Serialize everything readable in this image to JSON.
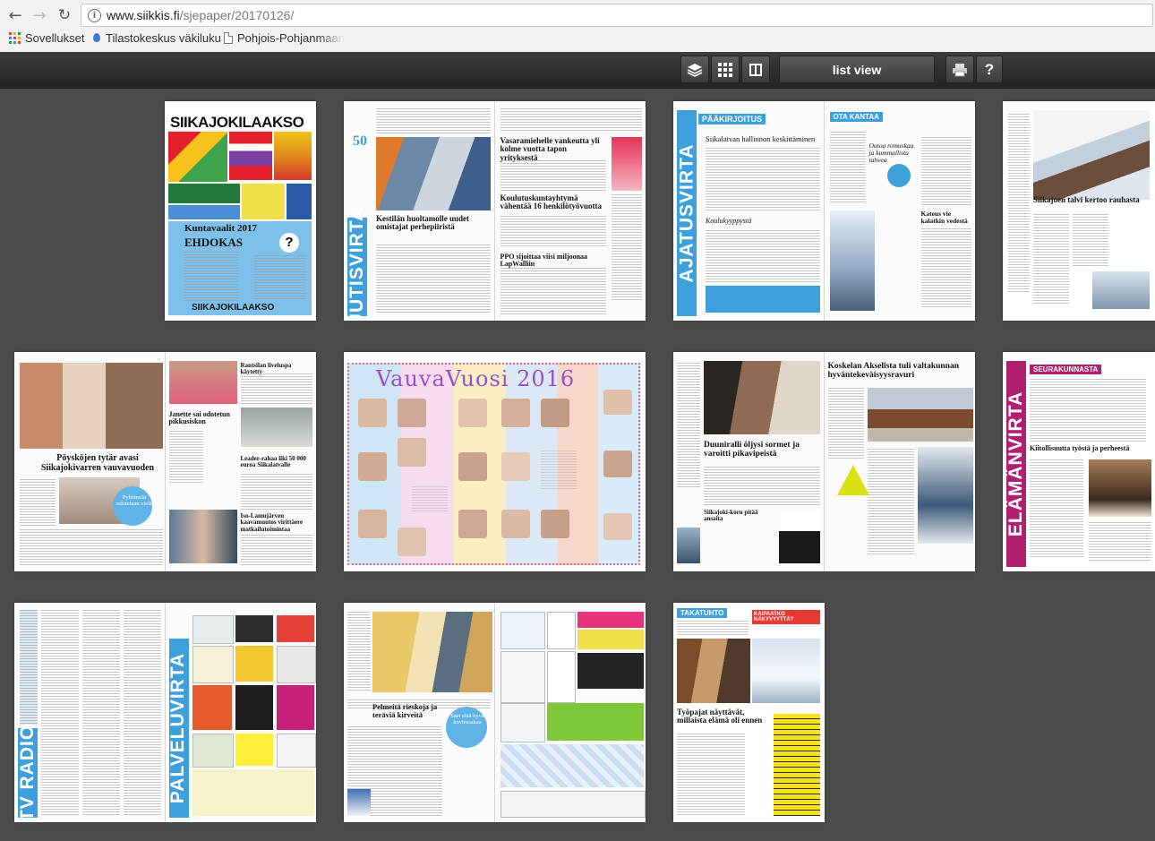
{
  "browser": {
    "url_host": "www.siikkis.fi",
    "url_path": "/sjepaper/20170126/",
    "bookmarks": [
      "Sovellukset",
      "Tilastokeskus väkiluku",
      "Pohjois-Pohjanmaan"
    ]
  },
  "toolbar": {
    "list_view_label": "list view",
    "help_label": "?",
    "icons": [
      "layers-icon",
      "grid-icon",
      "single-page-icon",
      "print-icon"
    ]
  },
  "pages": {
    "p1": {
      "masthead": "SIIKAJOKILAAKSO",
      "sub1": "Kuntavaalit 2017",
      "sub2": "EHDOKAS",
      "footer": "SIIKAJOKILAAKSO"
    },
    "p2": {
      "band": "UUTISVIRTA",
      "h1": "Kestilän huoltamolle uudet omistajat perhepiiristä",
      "h2": "Vasaramiehelle vankeutta yli kolme vuotta tapon yrityksestä",
      "h3": "Koulutuskuntayhtymä vähentää 16 henkilötyövuotta",
      "h4": "PPO sijoittaa viisi miljoonaa LapWalliin",
      "badge": "50"
    },
    "p3": {
      "band": "AJATUSVIRTA",
      "section": "PÄÄKIRJOITUS",
      "h1": "Siikalatvan hallinnon keskittäminen",
      "h2": "Koulukyyppystä"
    },
    "p4": {
      "section": "OTA KANTAA",
      "h1": "Outoa romuskaa ja kummallista tahvea",
      "h2": "Kateus vie kalatkin vedestä"
    },
    "p5": {
      "h1": "Siikajoen talvi kertoo rauhasta"
    },
    "p6": {
      "h1": "Pöysköjen tytär avasi Siikajokivarren vauvavuoden",
      "h2": "Pyhtämilä odotetaan vielä"
    },
    "p7": {
      "h1": "Rantsilan liveluspa käytetty",
      "h2": "Janette sai odotetun pikkusiskon",
      "h3": "Leader-rahaa liki 50 000 euroa Siikalatvalle",
      "h4": "Iso-Lamujärven kaavamuutos virittäere matkailutoimintaa"
    },
    "p8": {
      "title": "VauvaVuosi 2016"
    },
    "p9": {
      "h1": "Duuniralli öljysi sormet ja varoitti pikavipeistä",
      "h2": "Siikajoki-koru pitää ansaita"
    },
    "p10": {
      "h1": "Koskelan Akselista tuli valtakunnan hyväntekeväisyysravuri"
    },
    "p11": {
      "band": "ELÄMÄNVIRTA",
      "section": "SEURAKUNNASTA",
      "h1": "Kiitollisuutta työstä ja perheestä"
    },
    "p12": {
      "band": "TV RADIO"
    },
    "p13": {
      "band": "PALVELUVIRTA"
    },
    "p14": {
      "h1": "Pelmeitä rieskoja ja teräviä kirveitä",
      "h2": "Saat elää hyvä koviessakaa"
    },
    "p15": {
      "section": "TAKATUHTO",
      "h1": "Työpajat näyttävät, millaista elämä oli ennen",
      "ad": "KAIPAATKO NÄKYVYYTTÄ?"
    }
  },
  "colors": {
    "accent_blue": "#3d9fdb",
    "accent_magenta": "#b0206f",
    "toolbar_dark": "#2e2e2e",
    "background": "#4b4b4b"
  }
}
